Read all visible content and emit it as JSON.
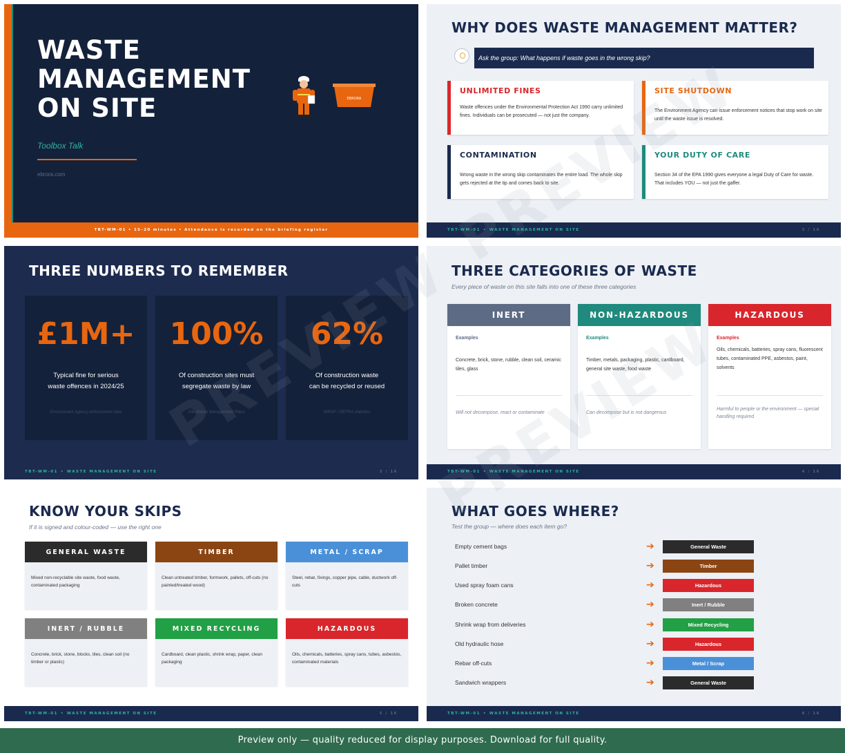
{
  "slide1": {
    "title": "WASTE MANAGEMENT ON SITE",
    "subtitle": "Toolbox Talk",
    "site": "ebrora.com",
    "footer": "TBT-WM-01  •  15–20 minutes  •  Attendance is recorded on the briefing register",
    "skip_label": "EBRORA"
  },
  "slide2": {
    "heading": "WHY DOES WASTE MANAGEMENT MATTER?",
    "question": "Ask the group: What happens if waste goes in the wrong skip?",
    "cards": [
      {
        "title": "UNLIMITED FINES",
        "body": "Waste offences under the Environmental Protection Act 1990 carry unlimited fines. Individuals can be prosecuted — not just the company.",
        "color": "#d9262c"
      },
      {
        "title": "SITE SHUTDOWN",
        "body": "The Environment Agency can issue enforcement notices that stop work on site until the waste issue is resolved.",
        "color": "#e8660f"
      },
      {
        "title": "CONTAMINATION",
        "body": "Wrong waste in the wrong skip contaminates the entire load. The whole skip gets rejected at the tip and comes back to site.",
        "color": "#1a2a4e"
      },
      {
        "title": "YOUR DUTY OF CARE",
        "body": "Section 34 of the EPA 1990 gives everyone a legal Duty of Care for waste. That includes YOU — not just the gaffer.",
        "color": "#1f8a7d"
      }
    ],
    "footer_code": "TBT-WM-01",
    "footer_title": "WASTE MANAGEMENT ON SITE",
    "page": "2 / 16"
  },
  "slide3": {
    "heading": "THREE NUMBERS TO REMEMBER",
    "stats": [
      {
        "value": "£1M+",
        "line1": "Typical fine for serious",
        "line2": "waste offences in 2024/25",
        "source": "Environment Agency enforcement data"
      },
      {
        "value": "100%",
        "line1": "Of construction sites must",
        "line2": "segregate waste by law",
        "source": "Site Waste Management Plans"
      },
      {
        "value": "62%",
        "line1": "Of construction waste",
        "line2": "can be recycled or reused",
        "source": "WRAP / DEFRA statistics"
      }
    ],
    "footer_code": "TBT-WM-01",
    "footer_title": "WASTE MANAGEMENT ON SITE",
    "page": "3 / 16"
  },
  "slide4": {
    "heading": "THREE CATEGORIES OF WASTE",
    "subheading": "Every piece of waste on this site falls into one of these three categories",
    "categories": [
      {
        "name": "INERT",
        "examples_label": "Examples",
        "items": "Concrete, brick, stone, rubble, clean soil, ceramic tiles, glass",
        "note": "Will not decompose, react or contaminate",
        "color": "#5d6b85"
      },
      {
        "name": "NON-HAZARDOUS",
        "examples_label": "Examples",
        "items": "Timber, metals, packaging, plastic, cardboard, general site waste, food waste",
        "note": "Can decompose but is not dangerous",
        "color": "#1f8a7d"
      },
      {
        "name": "HAZARDOUS",
        "examples_label": "Examples",
        "items": "Oils, chemicals, batteries, spray cans, fluorescent tubes, contaminated PPE, asbestos, paint, solvents",
        "note": "Harmful to people or the environment — special handling required",
        "color": "#d9262c"
      }
    ],
    "footer_code": "TBT-WM-01",
    "footer_title": "WASTE MANAGEMENT ON SITE",
    "page": "4 / 16"
  },
  "slide5": {
    "heading": "KNOW YOUR SKIPS",
    "subheading": "If it is signed and colour-coded — use the right one",
    "skips": [
      {
        "name": "GENERAL WASTE",
        "body": "Mixed non-recyclable site waste, food waste, contaminated packaging",
        "color": "#2b2b2b"
      },
      {
        "name": "TIMBER",
        "body": "Clean untreated timber, formwork, pallets, off-cuts (no painted/treated wood)",
        "color": "#8b4513"
      },
      {
        "name": "METAL / SCRAP",
        "body": "Steel, rebar, fixings, copper pipe, cable, ductwork off-cuts",
        "color": "#4a90d9"
      },
      {
        "name": "INERT / RUBBLE",
        "body": "Concrete, brick, stone, blocks, tiles, clean soil (no timber or plastic)",
        "color": "#808080"
      },
      {
        "name": "MIXED RECYCLING",
        "body": "Cardboard, clean plastic, shrink wrap, paper, clean packaging",
        "color": "#22a045"
      },
      {
        "name": "HAZARDOUS",
        "body": "Oils, chemicals, batteries, spray cans, tubes, asbestos, contaminated materials",
        "color": "#d9262c"
      }
    ],
    "footer_code": "TBT-WM-01",
    "footer_title": "WASTE MANAGEMENT ON SITE",
    "page": "5 / 16"
  },
  "slide6": {
    "heading": "WHAT GOES WHERE?",
    "subheading": "Test the group — where does each item go?",
    "rows": [
      {
        "item": "Empty cement bags",
        "answer": "General Waste",
        "color": "#2b2b2b"
      },
      {
        "item": "Pallet timber",
        "answer": "Timber",
        "color": "#8b4513"
      },
      {
        "item": "Used spray foam cans",
        "answer": "Hazardous",
        "color": "#d9262c"
      },
      {
        "item": "Broken concrete",
        "answer": "Inert / Rubble",
        "color": "#808080"
      },
      {
        "item": "Shrink wrap from deliveries",
        "answer": "Mixed Recycling",
        "color": "#22a045"
      },
      {
        "item": "Old hydraulic hose",
        "answer": "Hazardous",
        "color": "#d9262c"
      },
      {
        "item": "Rebar off-cuts",
        "answer": "Metal / Scrap",
        "color": "#4a90d9"
      },
      {
        "item": "Sandwich wrappers",
        "answer": "General Waste",
        "color": "#2b2b2b"
      }
    ],
    "arrow": "➔",
    "footer_code": "TBT-WM-01",
    "footer_title": "WASTE MANAGEMENT ON SITE",
    "page": "6 / 16"
  },
  "watermark": "PREVIEW",
  "banner": "Preview only  —  quality reduced for display purposes.  Download for full quality."
}
